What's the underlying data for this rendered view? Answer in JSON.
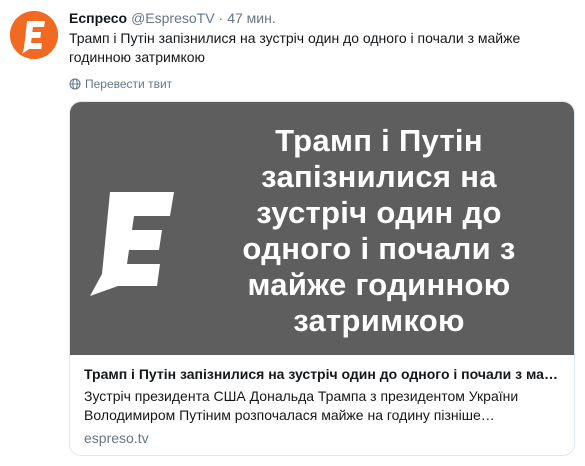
{
  "tweet": {
    "author": {
      "display_name": "Еспресо",
      "handle": "@EspresoTV",
      "avatar_icon": "espreso-logo-icon"
    },
    "separator": "·",
    "time": "47 мин.",
    "text": "Трамп і Путін запізнилися на зустріч один до одного і почали з майже годинною затримкою",
    "translate_label": "Перевести твит",
    "translate_icon": "globe-icon"
  },
  "card": {
    "image": {
      "logo_icon": "espreso-logo-icon",
      "headline": "Трамп і Путін запізнилися на зустріч один до одного і почали з майже годинною затримкою",
      "background": "#5e5e5e"
    },
    "title": "Трамп і Путін запізнилися на зустріч один до одного і почали з майже годинною затримкою",
    "description": "Зустріч президента США Дональда Трампа з президентом України Володимиром Путіним розпочалася майже на годину пізніше запланованого",
    "domain": "espreso.tv"
  },
  "colors": {
    "brand_orange": "#f26a21",
    "muted_text": "#657786",
    "border": "#e1e8ed"
  }
}
